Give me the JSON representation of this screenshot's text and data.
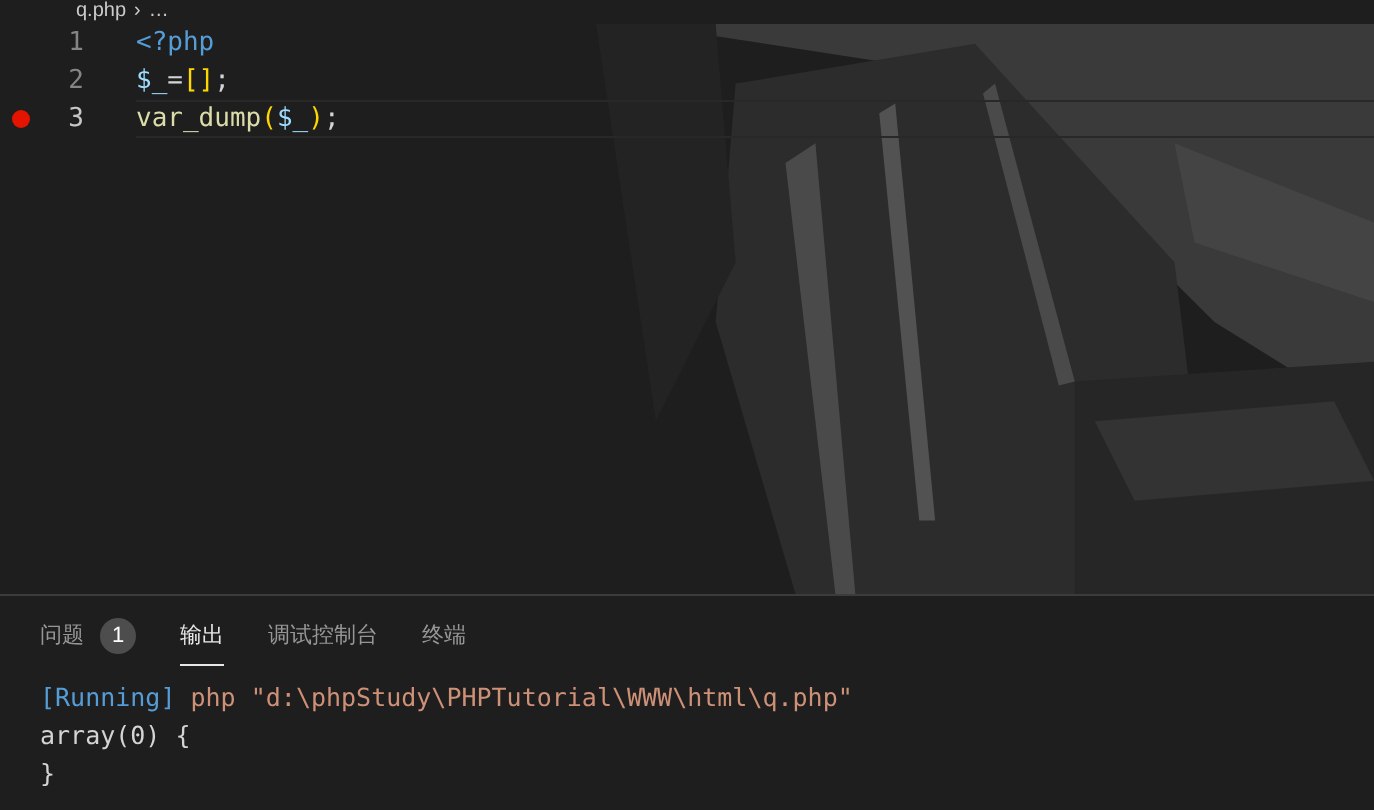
{
  "breadcrumb": {
    "file": "q.php",
    "separator": "›",
    "rest": "…"
  },
  "editor": {
    "lines": [
      {
        "number": "1",
        "breakpoint": false,
        "current": false,
        "tokens": [
          {
            "kind": "keyword",
            "text": "<?php"
          }
        ]
      },
      {
        "number": "2",
        "breakpoint": false,
        "current": false,
        "tokens": [
          {
            "kind": "variable",
            "text": "$_"
          },
          {
            "kind": "punct",
            "text": "="
          },
          {
            "kind": "bracket",
            "text": "[]"
          },
          {
            "kind": "punct",
            "text": ";"
          }
        ]
      },
      {
        "number": "3",
        "breakpoint": true,
        "current": true,
        "tokens": [
          {
            "kind": "func",
            "text": "var_dump"
          },
          {
            "kind": "bracket",
            "text": "("
          },
          {
            "kind": "variable",
            "text": "$_"
          },
          {
            "kind": "bracket",
            "text": ")"
          },
          {
            "kind": "punct",
            "text": ";"
          }
        ]
      }
    ]
  },
  "panel": {
    "tabs": [
      {
        "label": "问题",
        "badge": "1",
        "selected": false
      },
      {
        "label": "输出",
        "selected": true
      },
      {
        "label": "调试控制台",
        "selected": false
      },
      {
        "label": "终端",
        "selected": false
      }
    ],
    "output": [
      [
        {
          "kind": "keyword",
          "text": "[Running]"
        },
        {
          "kind": "string",
          "text": " php \"d:\\phpStudy\\PHPTutorial\\WWW\\html\\q.php\""
        }
      ],
      [
        {
          "kind": "plain",
          "text": "array(0) {"
        }
      ],
      [
        {
          "kind": "plain",
          "text": "}"
        }
      ]
    ]
  }
}
